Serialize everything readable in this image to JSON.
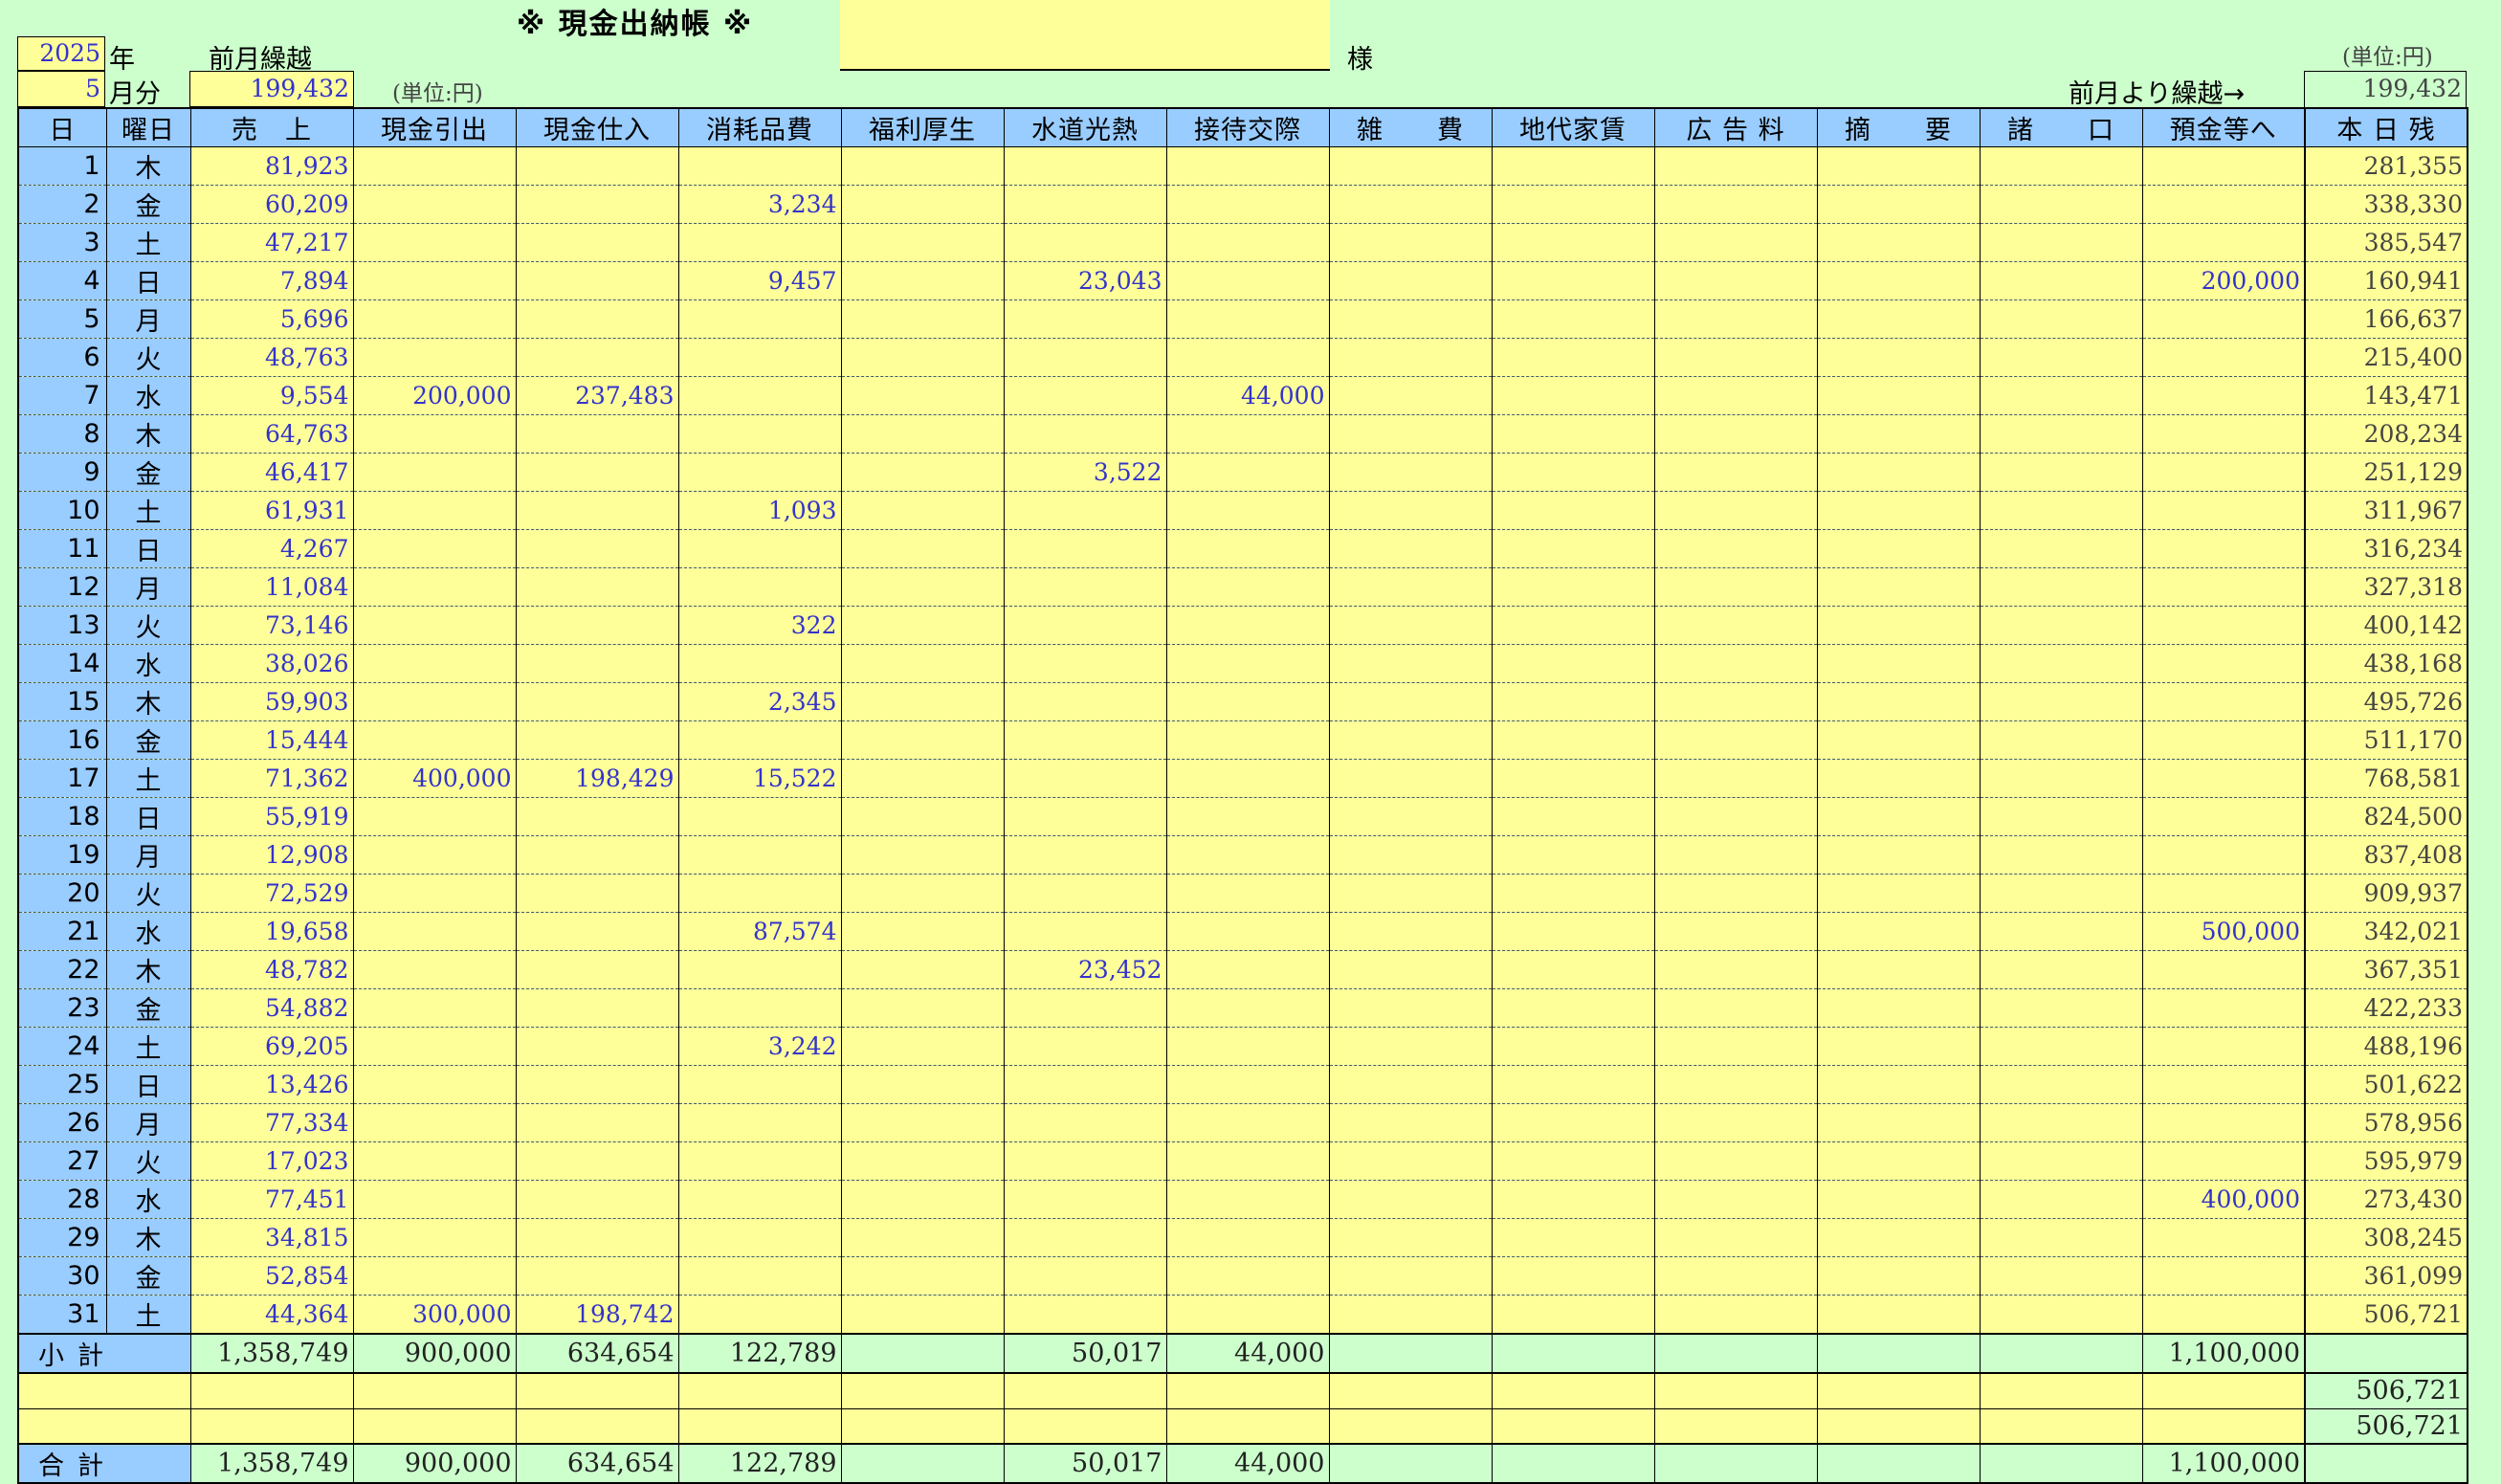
{
  "header": {
    "title": "※ 現金出納帳 ※",
    "year_value": "2025",
    "year_unit": "年",
    "month_value": "5",
    "month_unit": "月分",
    "prev_carry_label": "前月繰越",
    "prev_carry_value": "199,432",
    "unit_note_left": "(単位:円)",
    "name_value": "",
    "sama": "様",
    "unit_note_right": "(単位:円)",
    "carry_over_label": "前月より繰越→",
    "carry_over_value": "199,432"
  },
  "columns": [
    "日",
    "曜日",
    "売　上",
    "現金引出",
    "現金仕入",
    "消耗品費",
    "福利厚生",
    "水道光熱",
    "接待交際",
    "雑　　費",
    "地代家賃",
    "広 告 料",
    "摘　　要",
    "諸　　口",
    "預金等へ",
    "本 日 残"
  ],
  "rows": [
    {
      "day": "1",
      "wd": "木",
      "sales": "81,923",
      "withdraw": "",
      "purchase": "",
      "supplies": "",
      "welfare": "",
      "utilities": "",
      "entertain": "",
      "misc": "",
      "rent": "",
      "ads": "",
      "memo": "",
      "sundry": "",
      "deposit": "",
      "balance": "281,355"
    },
    {
      "day": "2",
      "wd": "金",
      "sales": "60,209",
      "withdraw": "",
      "purchase": "",
      "supplies": "3,234",
      "welfare": "",
      "utilities": "",
      "entertain": "",
      "misc": "",
      "rent": "",
      "ads": "",
      "memo": "",
      "sundry": "",
      "deposit": "",
      "balance": "338,330"
    },
    {
      "day": "3",
      "wd": "土",
      "sales": "47,217",
      "withdraw": "",
      "purchase": "",
      "supplies": "",
      "welfare": "",
      "utilities": "",
      "entertain": "",
      "misc": "",
      "rent": "",
      "ads": "",
      "memo": "",
      "sundry": "",
      "deposit": "",
      "balance": "385,547"
    },
    {
      "day": "4",
      "wd": "日",
      "sales": "7,894",
      "withdraw": "",
      "purchase": "",
      "supplies": "9,457",
      "welfare": "",
      "utilities": "23,043",
      "entertain": "",
      "misc": "",
      "rent": "",
      "ads": "",
      "memo": "",
      "sundry": "",
      "deposit": "200,000",
      "balance": "160,941"
    },
    {
      "day": "5",
      "wd": "月",
      "sales": "5,696",
      "withdraw": "",
      "purchase": "",
      "supplies": "",
      "welfare": "",
      "utilities": "",
      "entertain": "",
      "misc": "",
      "rent": "",
      "ads": "",
      "memo": "",
      "sundry": "",
      "deposit": "",
      "balance": "166,637"
    },
    {
      "day": "6",
      "wd": "火",
      "sales": "48,763",
      "withdraw": "",
      "purchase": "",
      "supplies": "",
      "welfare": "",
      "utilities": "",
      "entertain": "",
      "misc": "",
      "rent": "",
      "ads": "",
      "memo": "",
      "sundry": "",
      "deposit": "",
      "balance": "215,400"
    },
    {
      "day": "7",
      "wd": "水",
      "sales": "9,554",
      "withdraw": "200,000",
      "purchase": "237,483",
      "supplies": "",
      "welfare": "",
      "utilities": "",
      "entertain": "44,000",
      "misc": "",
      "rent": "",
      "ads": "",
      "memo": "",
      "sundry": "",
      "deposit": "",
      "balance": "143,471"
    },
    {
      "day": "8",
      "wd": "木",
      "sales": "64,763",
      "withdraw": "",
      "purchase": "",
      "supplies": "",
      "welfare": "",
      "utilities": "",
      "entertain": "",
      "misc": "",
      "rent": "",
      "ads": "",
      "memo": "",
      "sundry": "",
      "deposit": "",
      "balance": "208,234"
    },
    {
      "day": "9",
      "wd": "金",
      "sales": "46,417",
      "withdraw": "",
      "purchase": "",
      "supplies": "",
      "welfare": "",
      "utilities": "3,522",
      "entertain": "",
      "misc": "",
      "rent": "",
      "ads": "",
      "memo": "",
      "sundry": "",
      "deposit": "",
      "balance": "251,129"
    },
    {
      "day": "10",
      "wd": "土",
      "sales": "61,931",
      "withdraw": "",
      "purchase": "",
      "supplies": "1,093",
      "welfare": "",
      "utilities": "",
      "entertain": "",
      "misc": "",
      "rent": "",
      "ads": "",
      "memo": "",
      "sundry": "",
      "deposit": "",
      "balance": "311,967"
    },
    {
      "day": "11",
      "wd": "日",
      "sales": "4,267",
      "withdraw": "",
      "purchase": "",
      "supplies": "",
      "welfare": "",
      "utilities": "",
      "entertain": "",
      "misc": "",
      "rent": "",
      "ads": "",
      "memo": "",
      "sundry": "",
      "deposit": "",
      "balance": "316,234"
    },
    {
      "day": "12",
      "wd": "月",
      "sales": "11,084",
      "withdraw": "",
      "purchase": "",
      "supplies": "",
      "welfare": "",
      "utilities": "",
      "entertain": "",
      "misc": "",
      "rent": "",
      "ads": "",
      "memo": "",
      "sundry": "",
      "deposit": "",
      "balance": "327,318"
    },
    {
      "day": "13",
      "wd": "火",
      "sales": "73,146",
      "withdraw": "",
      "purchase": "",
      "supplies": "322",
      "welfare": "",
      "utilities": "",
      "entertain": "",
      "misc": "",
      "rent": "",
      "ads": "",
      "memo": "",
      "sundry": "",
      "deposit": "",
      "balance": "400,142"
    },
    {
      "day": "14",
      "wd": "水",
      "sales": "38,026",
      "withdraw": "",
      "purchase": "",
      "supplies": "",
      "welfare": "",
      "utilities": "",
      "entertain": "",
      "misc": "",
      "rent": "",
      "ads": "",
      "memo": "",
      "sundry": "",
      "deposit": "",
      "balance": "438,168"
    },
    {
      "day": "15",
      "wd": "木",
      "sales": "59,903",
      "withdraw": "",
      "purchase": "",
      "supplies": "2,345",
      "welfare": "",
      "utilities": "",
      "entertain": "",
      "misc": "",
      "rent": "",
      "ads": "",
      "memo": "",
      "sundry": "",
      "deposit": "",
      "balance": "495,726"
    },
    {
      "day": "16",
      "wd": "金",
      "sales": "15,444",
      "withdraw": "",
      "purchase": "",
      "supplies": "",
      "welfare": "",
      "utilities": "",
      "entertain": "",
      "misc": "",
      "rent": "",
      "ads": "",
      "memo": "",
      "sundry": "",
      "deposit": "",
      "balance": "511,170"
    },
    {
      "day": "17",
      "wd": "土",
      "sales": "71,362",
      "withdraw": "400,000",
      "purchase": "198,429",
      "supplies": "15,522",
      "welfare": "",
      "utilities": "",
      "entertain": "",
      "misc": "",
      "rent": "",
      "ads": "",
      "memo": "",
      "sundry": "",
      "deposit": "",
      "balance": "768,581"
    },
    {
      "day": "18",
      "wd": "日",
      "sales": "55,919",
      "withdraw": "",
      "purchase": "",
      "supplies": "",
      "welfare": "",
      "utilities": "",
      "entertain": "",
      "misc": "",
      "rent": "",
      "ads": "",
      "memo": "",
      "sundry": "",
      "deposit": "",
      "balance": "824,500"
    },
    {
      "day": "19",
      "wd": "月",
      "sales": "12,908",
      "withdraw": "",
      "purchase": "",
      "supplies": "",
      "welfare": "",
      "utilities": "",
      "entertain": "",
      "misc": "",
      "rent": "",
      "ads": "",
      "memo": "",
      "sundry": "",
      "deposit": "",
      "balance": "837,408"
    },
    {
      "day": "20",
      "wd": "火",
      "sales": "72,529",
      "withdraw": "",
      "purchase": "",
      "supplies": "",
      "welfare": "",
      "utilities": "",
      "entertain": "",
      "misc": "",
      "rent": "",
      "ads": "",
      "memo": "",
      "sundry": "",
      "deposit": "",
      "balance": "909,937"
    },
    {
      "day": "21",
      "wd": "水",
      "sales": "19,658",
      "withdraw": "",
      "purchase": "",
      "supplies": "87,574",
      "welfare": "",
      "utilities": "",
      "entertain": "",
      "misc": "",
      "rent": "",
      "ads": "",
      "memo": "",
      "sundry": "",
      "deposit": "500,000",
      "balance": "342,021"
    },
    {
      "day": "22",
      "wd": "木",
      "sales": "48,782",
      "withdraw": "",
      "purchase": "",
      "supplies": "",
      "welfare": "",
      "utilities": "23,452",
      "entertain": "",
      "misc": "",
      "rent": "",
      "ads": "",
      "memo": "",
      "sundry": "",
      "deposit": "",
      "balance": "367,351"
    },
    {
      "day": "23",
      "wd": "金",
      "sales": "54,882",
      "withdraw": "",
      "purchase": "",
      "supplies": "",
      "welfare": "",
      "utilities": "",
      "entertain": "",
      "misc": "",
      "rent": "",
      "ads": "",
      "memo": "",
      "sundry": "",
      "deposit": "",
      "balance": "422,233"
    },
    {
      "day": "24",
      "wd": "土",
      "sales": "69,205",
      "withdraw": "",
      "purchase": "",
      "supplies": "3,242",
      "welfare": "",
      "utilities": "",
      "entertain": "",
      "misc": "",
      "rent": "",
      "ads": "",
      "memo": "",
      "sundry": "",
      "deposit": "",
      "balance": "488,196"
    },
    {
      "day": "25",
      "wd": "日",
      "sales": "13,426",
      "withdraw": "",
      "purchase": "",
      "supplies": "",
      "welfare": "",
      "utilities": "",
      "entertain": "",
      "misc": "",
      "rent": "",
      "ads": "",
      "memo": "",
      "sundry": "",
      "deposit": "",
      "balance": "501,622"
    },
    {
      "day": "26",
      "wd": "月",
      "sales": "77,334",
      "withdraw": "",
      "purchase": "",
      "supplies": "",
      "welfare": "",
      "utilities": "",
      "entertain": "",
      "misc": "",
      "rent": "",
      "ads": "",
      "memo": "",
      "sundry": "",
      "deposit": "",
      "balance": "578,956"
    },
    {
      "day": "27",
      "wd": "火",
      "sales": "17,023",
      "withdraw": "",
      "purchase": "",
      "supplies": "",
      "welfare": "",
      "utilities": "",
      "entertain": "",
      "misc": "",
      "rent": "",
      "ads": "",
      "memo": "",
      "sundry": "",
      "deposit": "",
      "balance": "595,979"
    },
    {
      "day": "28",
      "wd": "水",
      "sales": "77,451",
      "withdraw": "",
      "purchase": "",
      "supplies": "",
      "welfare": "",
      "utilities": "",
      "entertain": "",
      "misc": "",
      "rent": "",
      "ads": "",
      "memo": "",
      "sundry": "",
      "deposit": "400,000",
      "balance": "273,430"
    },
    {
      "day": "29",
      "wd": "木",
      "sales": "34,815",
      "withdraw": "",
      "purchase": "",
      "supplies": "",
      "welfare": "",
      "utilities": "",
      "entertain": "",
      "misc": "",
      "rent": "",
      "ads": "",
      "memo": "",
      "sundry": "",
      "deposit": "",
      "balance": "308,245"
    },
    {
      "day": "30",
      "wd": "金",
      "sales": "52,854",
      "withdraw": "",
      "purchase": "",
      "supplies": "",
      "welfare": "",
      "utilities": "",
      "entertain": "",
      "misc": "",
      "rent": "",
      "ads": "",
      "memo": "",
      "sundry": "",
      "deposit": "",
      "balance": "361,099"
    },
    {
      "day": "31",
      "wd": "土",
      "sales": "44,364",
      "withdraw": "300,000",
      "purchase": "198,742",
      "supplies": "",
      "welfare": "",
      "utilities": "",
      "entertain": "",
      "misc": "",
      "rent": "",
      "ads": "",
      "memo": "",
      "sundry": "",
      "deposit": "",
      "balance": "506,721"
    }
  ],
  "subtotal": {
    "label": "小計",
    "sales": "1,358,749",
    "withdraw": "900,000",
    "purchase": "634,654",
    "supplies": "122,789",
    "welfare": "",
    "utilities": "50,017",
    "entertain": "44,000",
    "misc": "",
    "rent": "",
    "ads": "",
    "memo": "",
    "sundry": "",
    "deposit": "1,100,000",
    "balance": ""
  },
  "blank_rows": [
    {
      "balance": "506,721"
    },
    {
      "balance": "506,721"
    }
  ],
  "total": {
    "label": "合計",
    "sales": "1,358,749",
    "withdraw": "900,000",
    "purchase": "634,654",
    "supplies": "122,789",
    "welfare": "",
    "utilities": "50,017",
    "entertain": "44,000",
    "misc": "",
    "rent": "",
    "ads": "",
    "memo": "",
    "sundry": "",
    "deposit": "1,100,000",
    "balance": ""
  },
  "colors": {
    "background": "#ccffcc",
    "header_fill": "#99ccff",
    "input_fill": "#ffff99",
    "value_text": "#3333cc"
  }
}
